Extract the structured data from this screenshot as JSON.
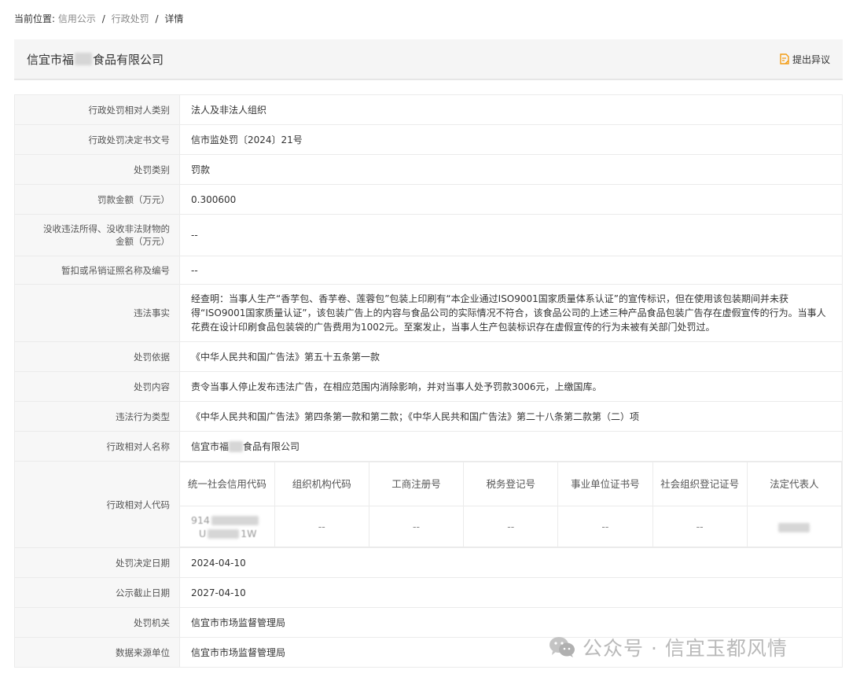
{
  "breadcrumb": {
    "label": "当前位置:",
    "items": [
      "信用公示",
      "行政处罚"
    ],
    "separator": "/",
    "current": "详情"
  },
  "header": {
    "company_prefix": "信宜市福",
    "company_suffix": "食品有限公司",
    "objection_label": "提出异议",
    "objection_icon": "doc-edit-icon",
    "accent_color": "#f39c12"
  },
  "details": {
    "subject_type": {
      "label": "行政处罚相对人类别",
      "value": "法人及非法人组织"
    },
    "decision_no": {
      "label": "行政处罚决定书文号",
      "value": "信市监处罚〔2024〕21号"
    },
    "penalty_type": {
      "label": "处罚类别",
      "value": "罚款"
    },
    "fine_amount": {
      "label": "罚款金额（万元）",
      "value": "0.300600"
    },
    "confiscation_amount": {
      "label_line1": "没收违法所得、没收非法财物的",
      "label_line2": "金额（万元）",
      "value": "--"
    },
    "license_revoked": {
      "label": "暂扣或吊销证照名称及编号",
      "value": "--"
    },
    "violation_facts": {
      "label": "违法事实",
      "value": "经查明：当事人生产“香芋包、香芋卷、莲蓉包”包装上印刷有“本企业通过ISO9001国家质量体系认证”的宣传标识，但在使用该包装期间并未获得“ISO9001国家质量认证”，该包装广告上的内容与食品公司的实际情况不符合，该食品公司的上述三种产品食品包装广告存在虚假宣传的行为。当事人花费在设计印刷食品包装袋的广告费用为1002元。至案发止，当事人生产包装标识存在虚假宣传的行为未被有关部门处罚过。"
    },
    "penalty_basis": {
      "label": "处罚依据",
      "value": "《中华人民共和国广告法》第五十五条第一款"
    },
    "penalty_content": {
      "label": "处罚内容",
      "value": "责令当事人停止发布违法广告，在相应范围内消除影响，并对当事人处予罚款3006元，上缴国库。"
    },
    "violation_type": {
      "label": "违法行为类型",
      "value": "《中华人民共和国广告法》第四条第一款和第二款；《中华人民共和国广告法》第二十八条第二款第（二）项"
    },
    "subject_name": {
      "label": "行政相对人名称",
      "value_prefix": "信宜市福",
      "value_suffix": "食品有限公司"
    },
    "subject_code": {
      "label": "行政相对人代码",
      "headers": [
        "统一社会信用代码",
        "组织机构代码",
        "工商注册号",
        "税务登记号",
        "事业单位证书号",
        "社会组织登记证号",
        "法定代表人"
      ],
      "values": [
        "914",
        "--",
        "--",
        "--",
        "--",
        "--",
        ""
      ],
      "credit_code_line2_start": "U",
      "credit_code_line2_end": "1W"
    },
    "decision_date": {
      "label": "处罚决定日期",
      "value": "2024-04-10"
    },
    "publicity_end_date": {
      "label": "公示截止日期",
      "value": "2027-04-10"
    },
    "authority": {
      "label": "处罚机关",
      "value": "信宜市市场监督管理局"
    },
    "data_source": {
      "label": "数据来源单位",
      "value": "信宜市市场监督管理局"
    }
  },
  "watermark": {
    "text": "公众号 · 信宜玉都风情",
    "icon": "wechat-icon"
  }
}
